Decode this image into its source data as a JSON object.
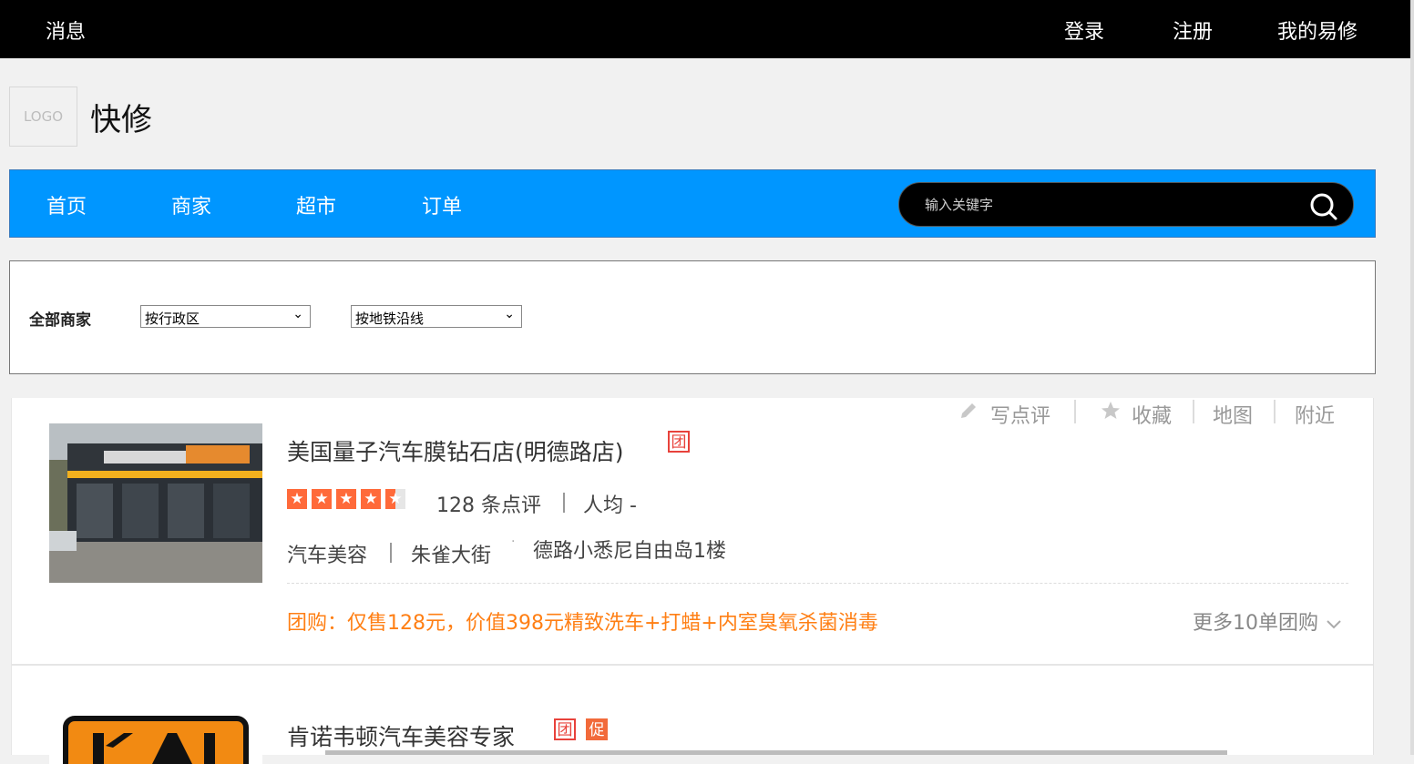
{
  "topbar": {
    "messages": "消息",
    "login": "登录",
    "register": "注册",
    "my_account": "我的易修"
  },
  "brand": {
    "logo_text": "LOGO",
    "title": "快修"
  },
  "nav": {
    "items": [
      "首页",
      "商家",
      "超市",
      "订单"
    ],
    "search_placeholder": "输入关键字"
  },
  "filters": {
    "label": "全部商家",
    "district_select": "按行政区",
    "metro_select": "按地铁沿线"
  },
  "listing": {
    "actions": [
      "写点评",
      "收藏",
      "地图",
      "附近"
    ],
    "shops": [
      {
        "name": "美国量子汽车膜钻石店(明德路店)",
        "badges": [
          "团"
        ],
        "rating": 4.5,
        "reviews": "128 条点评",
        "avg_price": "人均 -",
        "category": "汽车美容",
        "area": "朱雀大街",
        "address": "德路小悉尼自由岛1楼",
        "deal": "团购：仅售128元，价值398元精致洗车+打蜡+内室臭氧杀菌消毒",
        "more_deals": "更多10单团购"
      },
      {
        "name": "肯诺韦顿汽车美容专家",
        "badges": [
          "团",
          "促"
        ]
      }
    ]
  },
  "colors": {
    "nav_blue": "#0096ff",
    "star_orange": "#ff6a3a",
    "deal_orange": "#ff7f14",
    "badge_red": "#e8423b"
  }
}
